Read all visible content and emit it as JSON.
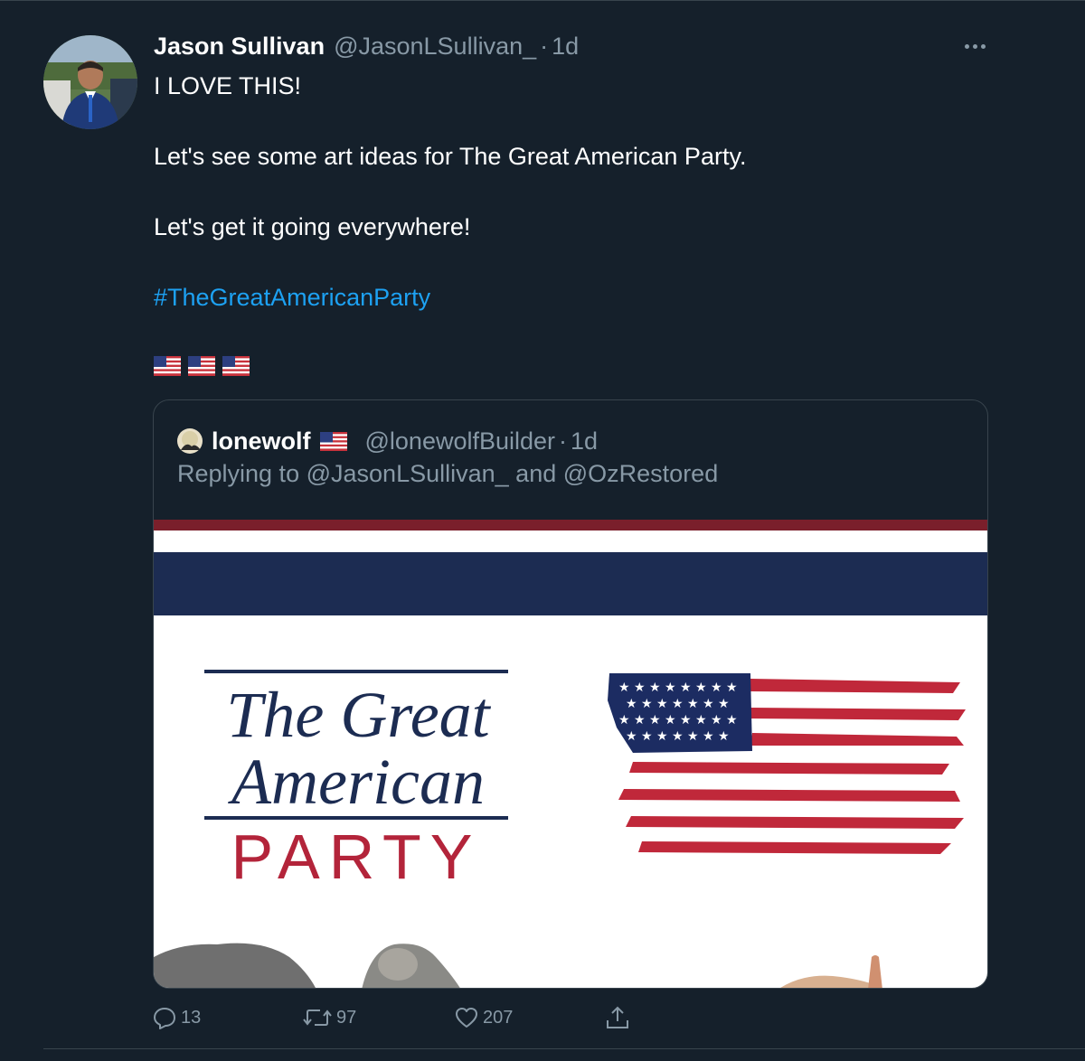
{
  "tweet": {
    "author_name": "Jason Sullivan",
    "handle": "@JasonLSullivan_",
    "separator": "·",
    "time": "1d",
    "lines": [
      "I LOVE THIS!",
      "Let's see some art ideas for The Great American Party.",
      "Let's get it going everywhere!"
    ],
    "hashtag": "#TheGreatAmericanParty",
    "flag_emoji_count": 3
  },
  "quoted": {
    "author_name": "lonewolf",
    "handle": "@lonewolfBuilder",
    "separator": "·",
    "time": "1d",
    "reply_prefix": "Replying to",
    "reply_mention_1": "@JasonLSullivan_",
    "reply_joiner": "and",
    "reply_mention_2": "@OzRestored",
    "image_logo": {
      "line1": "The Great",
      "line2": "American",
      "line3": "PARTY"
    }
  },
  "actions": {
    "replies": "13",
    "retweets": "97",
    "likes": "207"
  },
  "icons": [
    "more-icon",
    "reply-icon",
    "retweet-icon",
    "like-icon",
    "share-icon",
    "flag-icon"
  ],
  "colors": {
    "background": "#15202b",
    "link": "#1da1f2",
    "secondary_text": "#8899a6",
    "border": "#38444d",
    "logo_navy": "#1c2c52",
    "logo_red": "#b3243a"
  }
}
